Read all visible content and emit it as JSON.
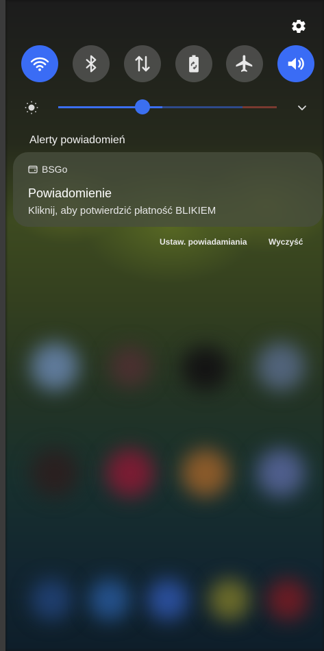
{
  "quick_settings": {
    "tiles": [
      {
        "icon": "wifi-icon",
        "active": true
      },
      {
        "icon": "bluetooth-icon",
        "active": false
      },
      {
        "icon": "mobile-data-icon",
        "active": false
      },
      {
        "icon": "power-saving-icon",
        "active": false
      },
      {
        "icon": "airplane-icon",
        "active": false
      },
      {
        "icon": "sound-icon",
        "active": true
      }
    ],
    "accent_color": "#3a6cf5"
  },
  "brightness": {
    "level": 0.36
  },
  "notifications": {
    "section_title": "Alerty powiadomień",
    "items": [
      {
        "app_name": "BSGo",
        "title": "Powiadomienie",
        "text": "Kliknij, aby potwierdzić płatność BLIKIEM"
      }
    ],
    "actions": {
      "settings_label": "Ustaw. powiadamiania",
      "clear_label": "Wyczyść"
    }
  }
}
